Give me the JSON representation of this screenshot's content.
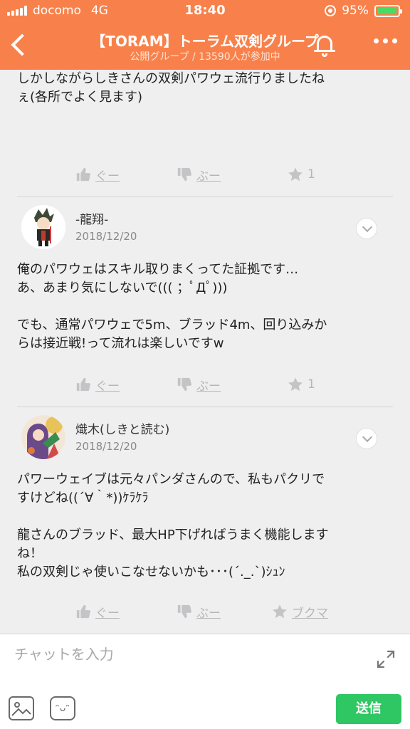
{
  "status": {
    "carrier": "docomo",
    "network": "4G",
    "time": "18:40",
    "battery": "95%",
    "battery_level": 0.95
  },
  "header": {
    "title": "【TORAM】トーラム双剣グループ",
    "subtitle": "公開グループ / 13590人が参加中"
  },
  "posts": [
    {
      "text": "しかしながらしきさんの双剣パワウェ流行りましたね\nぇ(各所でよく見ます)",
      "actions": {
        "good": "ぐー",
        "boo": "ぶー",
        "star": "1"
      }
    },
    {
      "user": "-龍翔-",
      "date": "2018/12/20",
      "text": "俺のパワウェはスキル取りまくってた証拠です…\nあ、あまり気にしないで((( ；ﾟДﾟ)))\n\nでも、通常パワウェで5m、ブラッド4m、回り込みか\nらは接近戦!って流れは楽しいですw",
      "actions": {
        "good": "ぐー",
        "boo": "ぶー",
        "star": "1"
      }
    },
    {
      "user": "熾木(しきと読む)",
      "date": "2018/12/20",
      "text": "パワーウェイブは元々パンダさんので、私もパクリで\nすけどね((´∀｀*))ｹﾗｹﾗ\n\n龍さんのブラッド、最大HP下げればうまく機能します\nね！\n私の双剣じゃ使いこなせないかも･･･(´._.`)ｼｭﾝ",
      "actions": {
        "good": "ぐー",
        "boo": "ぶー",
        "star": "ブクマ"
      }
    }
  ],
  "composer": {
    "placeholder": "チャットを入力",
    "send_label": "送信",
    "stamp_glyph": "ᵔᴗᵔ"
  },
  "colors": {
    "accent": "#f8814b",
    "send": "#2ec763",
    "background": "#efeff0"
  }
}
